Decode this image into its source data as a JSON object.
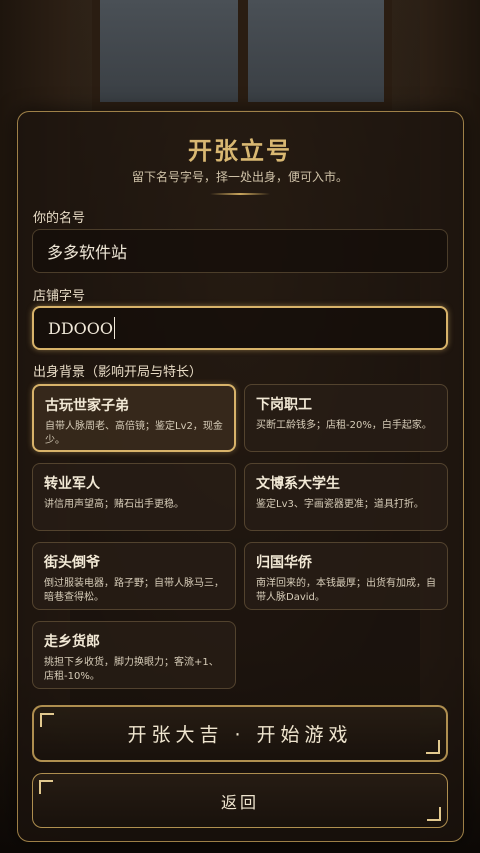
{
  "header": {
    "title": "开张立号",
    "subtitle": "留下名号字号，择一处出身，便可入市。"
  },
  "form": {
    "name_label": "你的名号",
    "name_value": "多多软件站",
    "shop_label": "店铺字号",
    "shop_value": "DDOOO",
    "background_label": "出身背景（影响开局与特长）"
  },
  "backgrounds": [
    {
      "title": "古玩世家子弟",
      "desc": "自带人脉周老、高倍镜；鉴定Lv2，现金少。",
      "selected": true
    },
    {
      "title": "下岗职工",
      "desc": "买断工龄钱多；店租-20%，白手起家。",
      "selected": false
    },
    {
      "title": "转业军人",
      "desc": "讲信用声望高；赌石出手更稳。",
      "selected": false
    },
    {
      "title": "文博系大学生",
      "desc": "鉴定Lv3、字画瓷器更准；道具打折。",
      "selected": false
    },
    {
      "title": "街头倒爷",
      "desc": "倒过服装电器，路子野；自带人脉马三，暗巷查得松。",
      "selected": false
    },
    {
      "title": "归国华侨",
      "desc": "南洋回来的，本钱最厚；出货有加成，自带人脉David。",
      "selected": false
    },
    {
      "title": "走乡货郎",
      "desc": "挑担下乡收货，脚力换眼力；客流+1、店租-10%。",
      "selected": false
    }
  ],
  "actions": {
    "start_label": "开张大吉 · 开始游戏",
    "back_label": "返回"
  },
  "colors": {
    "accent": "#d8b36a",
    "title": "#d9b872",
    "panel": "#1c140e"
  }
}
